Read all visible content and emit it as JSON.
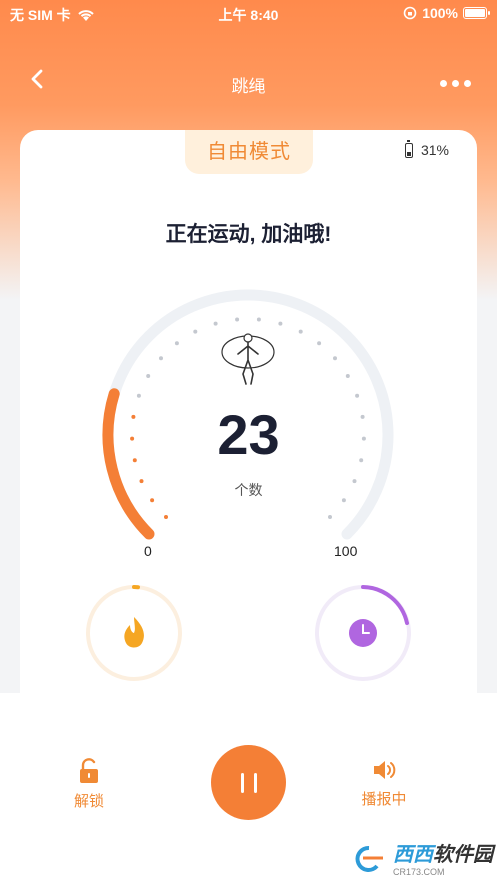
{
  "status_bar": {
    "carrier": "无 SIM 卡",
    "time": "上午 8:40",
    "battery": "100%"
  },
  "nav": {
    "title": "跳绳"
  },
  "card": {
    "mode": "自由模式",
    "device_battery": "31%",
    "cheer": "正在运动, 加油哦!",
    "count": "23",
    "count_label": "个数",
    "min_label": "0",
    "max_label": "100",
    "progress_fraction": 0.23
  },
  "bottom": {
    "unlock_label": "解锁",
    "broadcast_label": "播报中"
  },
  "watermark": {
    "brand_a": "西西",
    "brand_b": "软件园",
    "url": "CR173.COM"
  },
  "colors": {
    "accent": "#f47f36",
    "purple": "#b066e0",
    "flame": "#f5a623"
  }
}
